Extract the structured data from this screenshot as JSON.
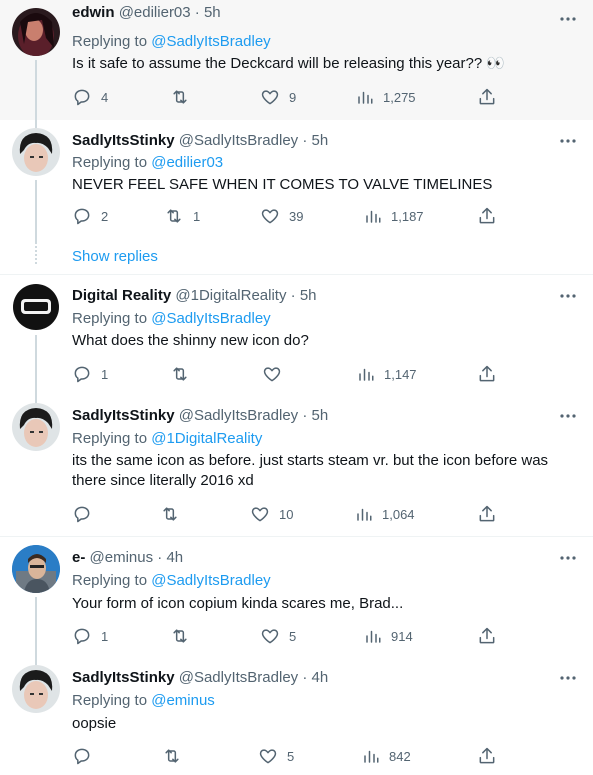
{
  "tweets": [
    {
      "display_name": "edwin",
      "handle": "@edilier03",
      "time": "5h",
      "replying_label": "Replying to",
      "replying_to": "@SadlyItsBradley",
      "text": "Is it safe to assume the Deckcard will be releasing this year?? 👀",
      "replies": "4",
      "retweets": "",
      "likes": "9",
      "views": "1,275"
    },
    {
      "display_name": "SadlyItsStinky",
      "handle": "@SadlyItsBradley",
      "time": "5h",
      "replying_label": "Replying to",
      "replying_to": "@edilier03",
      "text": "NEVER FEEL SAFE WHEN IT COMES TO VALVE TIMELINES",
      "replies": "2",
      "retweets": "1",
      "likes": "39",
      "views": "1,187"
    },
    {
      "display_name": "Digital Reality",
      "handle": "@1DigitalReality",
      "time": "5h",
      "replying_label": "Replying to",
      "replying_to": "@SadlyItsBradley",
      "text": "What does the shinny new icon do?",
      "replies": "1",
      "retweets": "",
      "likes": "",
      "views": "1,147"
    },
    {
      "display_name": "SadlyItsStinky",
      "handle": "@SadlyItsBradley",
      "time": "5h",
      "replying_label": "Replying to",
      "replying_to": "@1DigitalReality",
      "text": "its the same icon as before. just starts steam vr. but the icon before was there since literally 2016 xd",
      "replies": "",
      "retweets": "",
      "likes": "10",
      "views": "1,064"
    },
    {
      "display_name": "e-",
      "handle": "@eminus",
      "time": "4h",
      "replying_label": "Replying to",
      "replying_to": "@SadlyItsBradley",
      "text": "Your form of icon copium kinda scares me, Brad...",
      "replies": "1",
      "retweets": "",
      "likes": "5",
      "views": "914"
    },
    {
      "display_name": "SadlyItsStinky",
      "handle": "@SadlyItsBradley",
      "time": "4h",
      "replying_label": "Replying to",
      "replying_to": "@eminus",
      "text": "oopsie",
      "replies": "",
      "retweets": "",
      "likes": "5",
      "views": "842"
    }
  ],
  "show_replies_label": "Show replies",
  "separator": "·",
  "colors": {
    "accent": "#1d9bf0",
    "secondary_text": "#536471",
    "thread_line": "#cfd9de",
    "highlight_bg": "#f7f7f7"
  },
  "icons": [
    "reply-icon",
    "retweet-icon",
    "like-icon",
    "views-icon",
    "share-icon",
    "more-icon"
  ]
}
